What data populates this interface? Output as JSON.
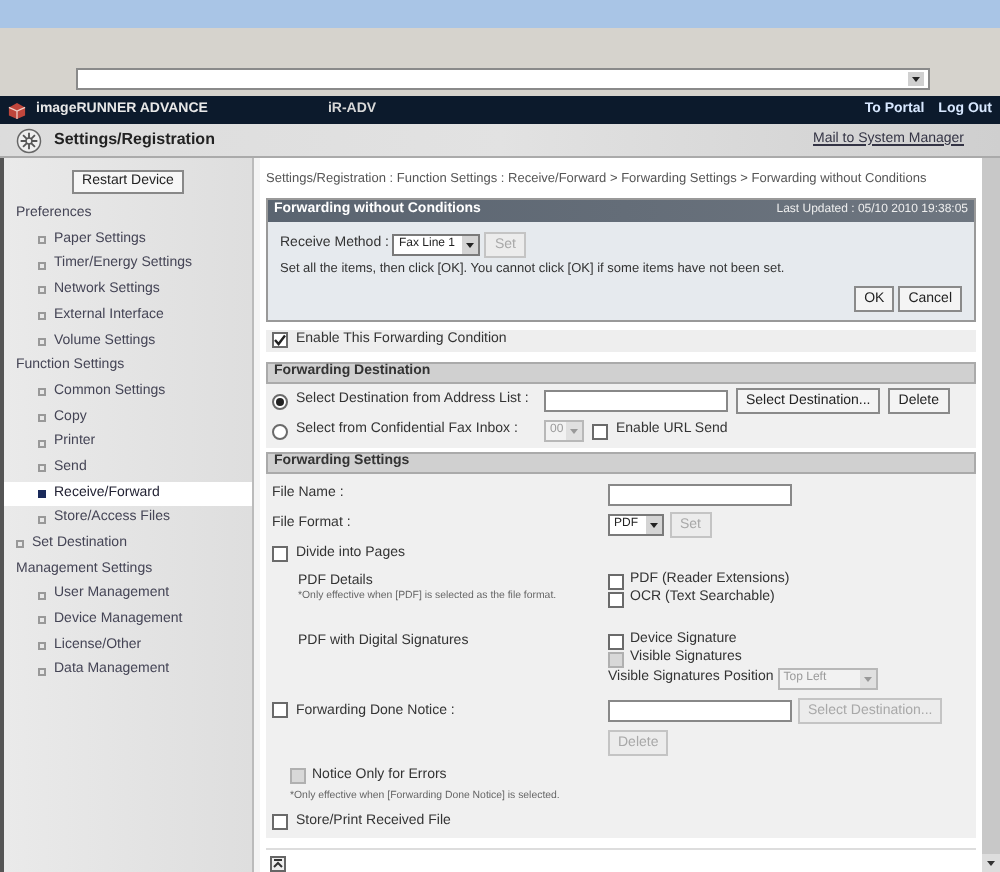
{
  "header": {
    "product": "imageRUNNER ADVANCE",
    "device": "iR-ADV",
    "links": [
      "To Portal",
      "Log Out"
    ]
  },
  "subheader": {
    "title": "Settings/Registration",
    "link": "Mail to System Manager"
  },
  "sidebar": {
    "restart_button": "Restart Device",
    "sections": [
      {
        "kind": "group",
        "label": "Preferences",
        "items": [
          {
            "label": "Paper Settings",
            "selected": false
          },
          {
            "label": "Timer/Energy Settings",
            "selected": false
          },
          {
            "label": "Network Settings",
            "selected": false
          },
          {
            "label": "External Interface",
            "selected": false
          },
          {
            "label": "Volume Settings",
            "selected": false
          }
        ]
      },
      {
        "kind": "group",
        "label": "Function Settings",
        "items": [
          {
            "label": "Common Settings",
            "selected": false
          },
          {
            "label": "Copy",
            "selected": false
          },
          {
            "label": "Printer",
            "selected": false
          },
          {
            "label": "Send",
            "selected": false
          },
          {
            "label": "Receive/Forward",
            "selected": true
          },
          {
            "label": "Store/Access Files",
            "selected": false
          }
        ]
      },
      {
        "kind": "link",
        "label": "Set Destination",
        "selected": false
      },
      {
        "kind": "group",
        "label": "Management Settings",
        "items": [
          {
            "label": "User Management",
            "selected": false
          },
          {
            "label": "Device Management",
            "selected": false
          },
          {
            "label": "License/Other",
            "selected": false
          },
          {
            "label": "Data Management",
            "selected": false
          }
        ]
      }
    ]
  },
  "breadcrumb": "Settings/Registration : Function Settings : Receive/Forward > Forwarding Settings > Forwarding without Conditions",
  "panel": {
    "title": "Forwarding without Conditions",
    "last_updated": "Last Updated : 05/10 2010 19:38:05",
    "receive_method_label": "Receive Method :",
    "receive_method_value": "Fax Line 1",
    "set_button": {
      "label": "Set",
      "disabled": true
    },
    "instructions": "Set all the items, then click [OK]. You cannot click [OK] if some items have not been set.",
    "buttons": [
      "OK",
      "Cancel"
    ]
  },
  "enable_condition": {
    "label": "Enable This Forwarding Condition",
    "checked": true
  },
  "destination": {
    "title": "Forwarding Destination",
    "options": [
      {
        "label": "Select Destination from Address List :",
        "selected": true
      },
      {
        "label": "Select from Confidential Fax Inbox :",
        "selected": false
      }
    ],
    "select_button": {
      "label": "Select Destination...",
      "disabled": false
    },
    "delete_button": {
      "label": "Delete",
      "disabled": false
    },
    "inbox_value": "00",
    "inbox_disabled": true,
    "url_send": {
      "label": "Enable URL Send",
      "checked": false
    }
  },
  "forwarding_settings": {
    "title": "Forwarding Settings",
    "file_name_label": "File Name :",
    "file_format_label": "File Format :",
    "file_format_value": "PDF",
    "format_set_button": {
      "label": "Set",
      "disabled": true
    },
    "divide_pages": {
      "label": "Divide into Pages",
      "checked": false
    },
    "pdf_details": {
      "label": "PDF Details",
      "note": "*Only effective when [PDF] is selected as the file format.",
      "options": [
        {
          "label": "PDF (Reader Extensions)",
          "checked": false,
          "disabled": false
        },
        {
          "label": "OCR (Text Searchable)",
          "checked": false,
          "disabled": false
        }
      ]
    },
    "digital_signatures": {
      "label": "PDF with Digital Signatures",
      "options": [
        {
          "label": "Device Signature",
          "checked": false,
          "disabled": false
        },
        {
          "label": "Visible Signatures",
          "checked": false,
          "disabled": true
        }
      ],
      "position_label": "Visible Signatures Position",
      "position_value": "Top Left",
      "position_disabled": true
    },
    "done_notice": {
      "label": "Forwarding Done Notice :",
      "checked": false,
      "select_button": {
        "label": "Select Destination...",
        "disabled": true
      },
      "delete_button": {
        "label": "Delete",
        "disabled": true
      },
      "errors_only": {
        "label": "Notice Only for Errors",
        "checked": false,
        "disabled": true
      },
      "note": "*Only effective when [Forwarding Done Notice] is selected."
    },
    "store_print": {
      "label": "Store/Print Received File",
      "checked": false
    }
  }
}
